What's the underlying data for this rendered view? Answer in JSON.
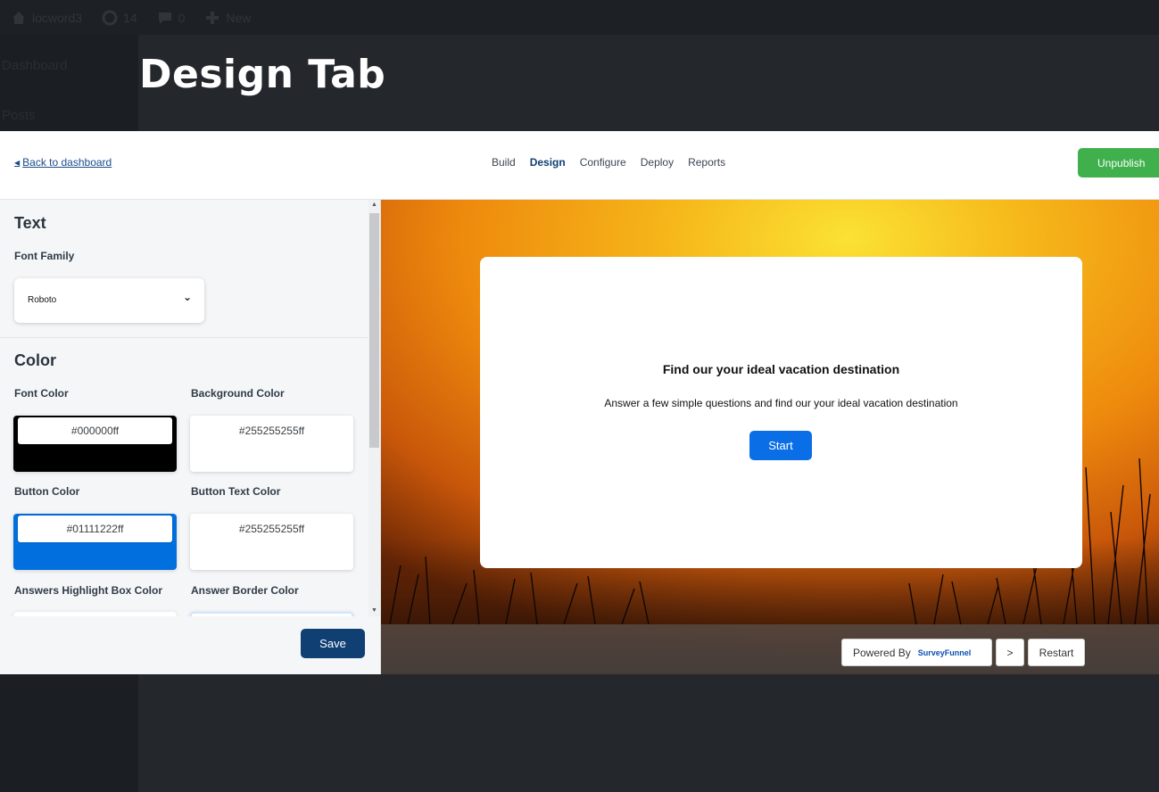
{
  "overlay": {
    "title": "Design Tab"
  },
  "wp": {
    "site_name": "locword3",
    "updates_count": "14",
    "comments_count": "0",
    "new_label": "New",
    "menu": [
      "Dashboard",
      "Posts"
    ]
  },
  "topbar": {
    "back_label": "Back to dashboard",
    "tabs": [
      "Build",
      "Design",
      "Configure",
      "Deploy",
      "Reports"
    ],
    "active_tab": "Design",
    "unpublish_label": "Unpublish"
  },
  "panel": {
    "text_section": "Text",
    "font_family_label": "Font Family",
    "font_family_value": "Roboto",
    "color_section": "Color",
    "colors": [
      {
        "label": "Font Color",
        "value": "#000000ff",
        "swatch": "#000000"
      },
      {
        "label": "Background Color",
        "value": "#255255255ff",
        "swatch": "#ffffff"
      },
      {
        "label": "Button Color",
        "value": "#01111222ff",
        "swatch": "#016fde"
      },
      {
        "label": "Button Text Color",
        "value": "#255255255ff",
        "swatch": "#ffffff"
      },
      {
        "label": "Answers Highlight Box Color",
        "swatch": "#ffffff"
      },
      {
        "label": "Answer Border Color",
        "swatch": "#d6ebff"
      }
    ],
    "save_label": "Save"
  },
  "preview": {
    "card_title": "Find our your ideal vacation destination",
    "card_subtitle": "Answer a few simple questions and find our your ideal vacation destination",
    "start_label": "Start",
    "powered_by": "Powered By",
    "brand": "SurveyFunnel",
    "next_label": ">",
    "restart_label": "Restart"
  }
}
